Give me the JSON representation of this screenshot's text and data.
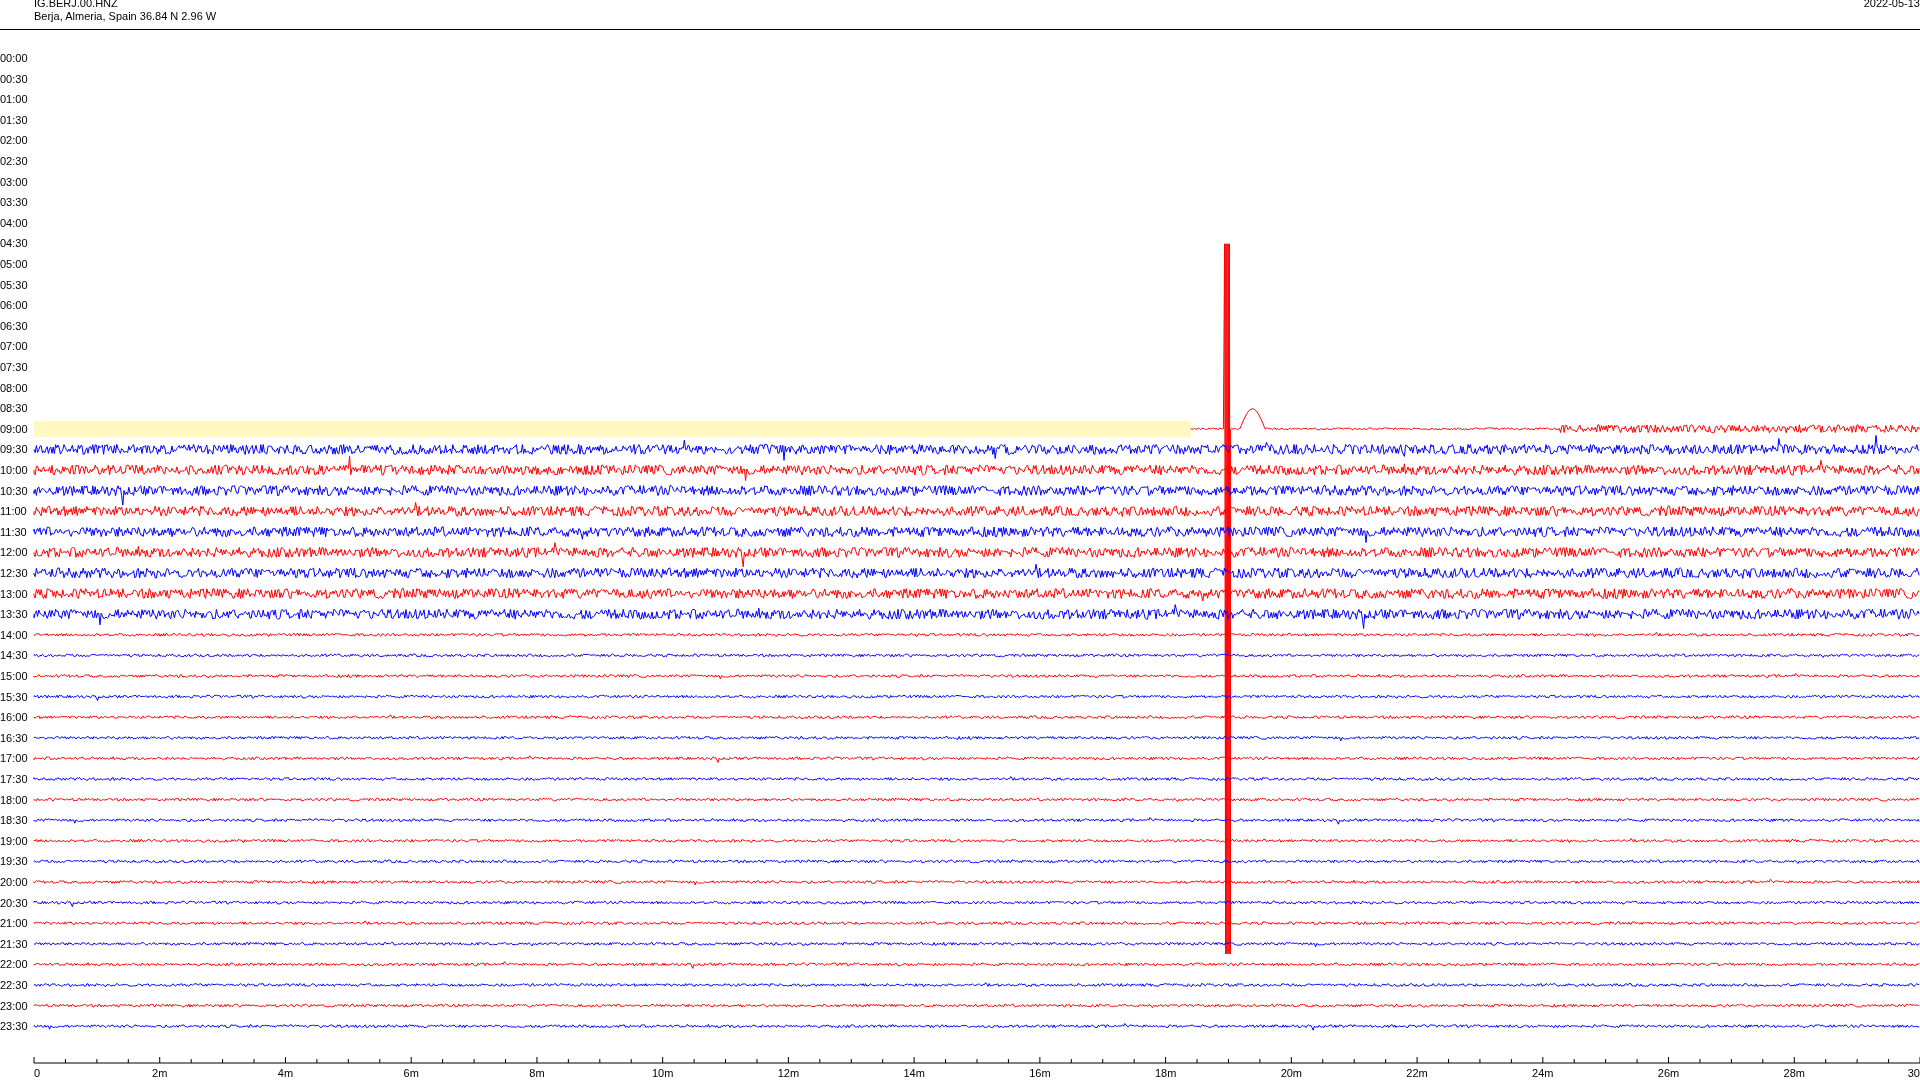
{
  "header": {
    "station": "IG.BERJ.00.HNZ",
    "location": "Berja, Almeria, Spain  36.84 N 2.96 W",
    "date": "2022-05-13"
  },
  "rows": [
    {
      "label": "00:00",
      "kind": "empty"
    },
    {
      "label": "00:30",
      "kind": "empty"
    },
    {
      "label": "01:00",
      "kind": "empty"
    },
    {
      "label": "01:30",
      "kind": "empty"
    },
    {
      "label": "02:00",
      "kind": "empty"
    },
    {
      "label": "02:30",
      "kind": "empty"
    },
    {
      "label": "03:00",
      "kind": "empty"
    },
    {
      "label": "03:30",
      "kind": "empty"
    },
    {
      "label": "04:00",
      "kind": "empty"
    },
    {
      "label": "04:30",
      "kind": "empty"
    },
    {
      "label": "05:00",
      "kind": "empty"
    },
    {
      "label": "05:30",
      "kind": "empty"
    },
    {
      "label": "06:00",
      "kind": "empty"
    },
    {
      "label": "06:30",
      "kind": "empty"
    },
    {
      "label": "07:00",
      "kind": "empty"
    },
    {
      "label": "07:30",
      "kind": "empty"
    },
    {
      "label": "08:00",
      "kind": "empty"
    },
    {
      "label": "08:30",
      "kind": "empty"
    },
    {
      "label": "09:00",
      "kind": "partial",
      "color": "#ff0000"
    },
    {
      "label": "09:30",
      "kind": "full",
      "color": "#0000ff"
    },
    {
      "label": "10:00",
      "kind": "full",
      "color": "#ff0000"
    },
    {
      "label": "10:30",
      "kind": "full",
      "color": "#0000ff"
    },
    {
      "label": "11:00",
      "kind": "full",
      "color": "#ff0000"
    },
    {
      "label": "11:30",
      "kind": "full",
      "color": "#0000ff"
    },
    {
      "label": "12:00",
      "kind": "full",
      "color": "#ff0000"
    },
    {
      "label": "12:30",
      "kind": "full",
      "color": "#0000ff"
    },
    {
      "label": "13:00",
      "kind": "full",
      "color": "#ff0000"
    },
    {
      "label": "13:30",
      "kind": "full",
      "color": "#0000ff"
    },
    {
      "label": "14:00",
      "kind": "full",
      "color": "#ff0000"
    },
    {
      "label": "14:30",
      "kind": "full",
      "color": "#0000ff"
    },
    {
      "label": "15:00",
      "kind": "full",
      "color": "#ff0000"
    },
    {
      "label": "15:30",
      "kind": "full",
      "color": "#0000ff"
    },
    {
      "label": "16:00",
      "kind": "full",
      "color": "#ff0000"
    },
    {
      "label": "16:30",
      "kind": "full",
      "color": "#0000ff"
    },
    {
      "label": "17:00",
      "kind": "full",
      "color": "#ff0000"
    },
    {
      "label": "17:30",
      "kind": "full",
      "color": "#0000ff"
    },
    {
      "label": "18:00",
      "kind": "full",
      "color": "#ff0000"
    },
    {
      "label": "18:30",
      "kind": "full",
      "color": "#0000ff"
    },
    {
      "label": "19:00",
      "kind": "full",
      "color": "#ff0000"
    },
    {
      "label": "19:30",
      "kind": "full",
      "color": "#0000ff"
    },
    {
      "label": "20:00",
      "kind": "full",
      "color": "#ff0000"
    },
    {
      "label": "20:30",
      "kind": "full",
      "color": "#0000ff"
    },
    {
      "label": "21:00",
      "kind": "full",
      "color": "#ff0000"
    },
    {
      "label": "21:30",
      "kind": "full",
      "color": "#0000ff"
    },
    {
      "label": "22:00",
      "kind": "full",
      "color": "#ff0000"
    },
    {
      "label": "22:30",
      "kind": "full",
      "color": "#0000ff"
    },
    {
      "label": "23:00",
      "kind": "full",
      "color": "#ff0000"
    },
    {
      "label": "23:30",
      "kind": "full",
      "color": "#0000ff"
    }
  ],
  "x_axis": {
    "labels": [
      "0",
      "2m",
      "4m",
      "6m",
      "8m",
      "10m",
      "12m",
      "14m",
      "16m",
      "18m",
      "20m",
      "22m",
      "24m",
      "26m",
      "28m",
      "30"
    ]
  }
}
